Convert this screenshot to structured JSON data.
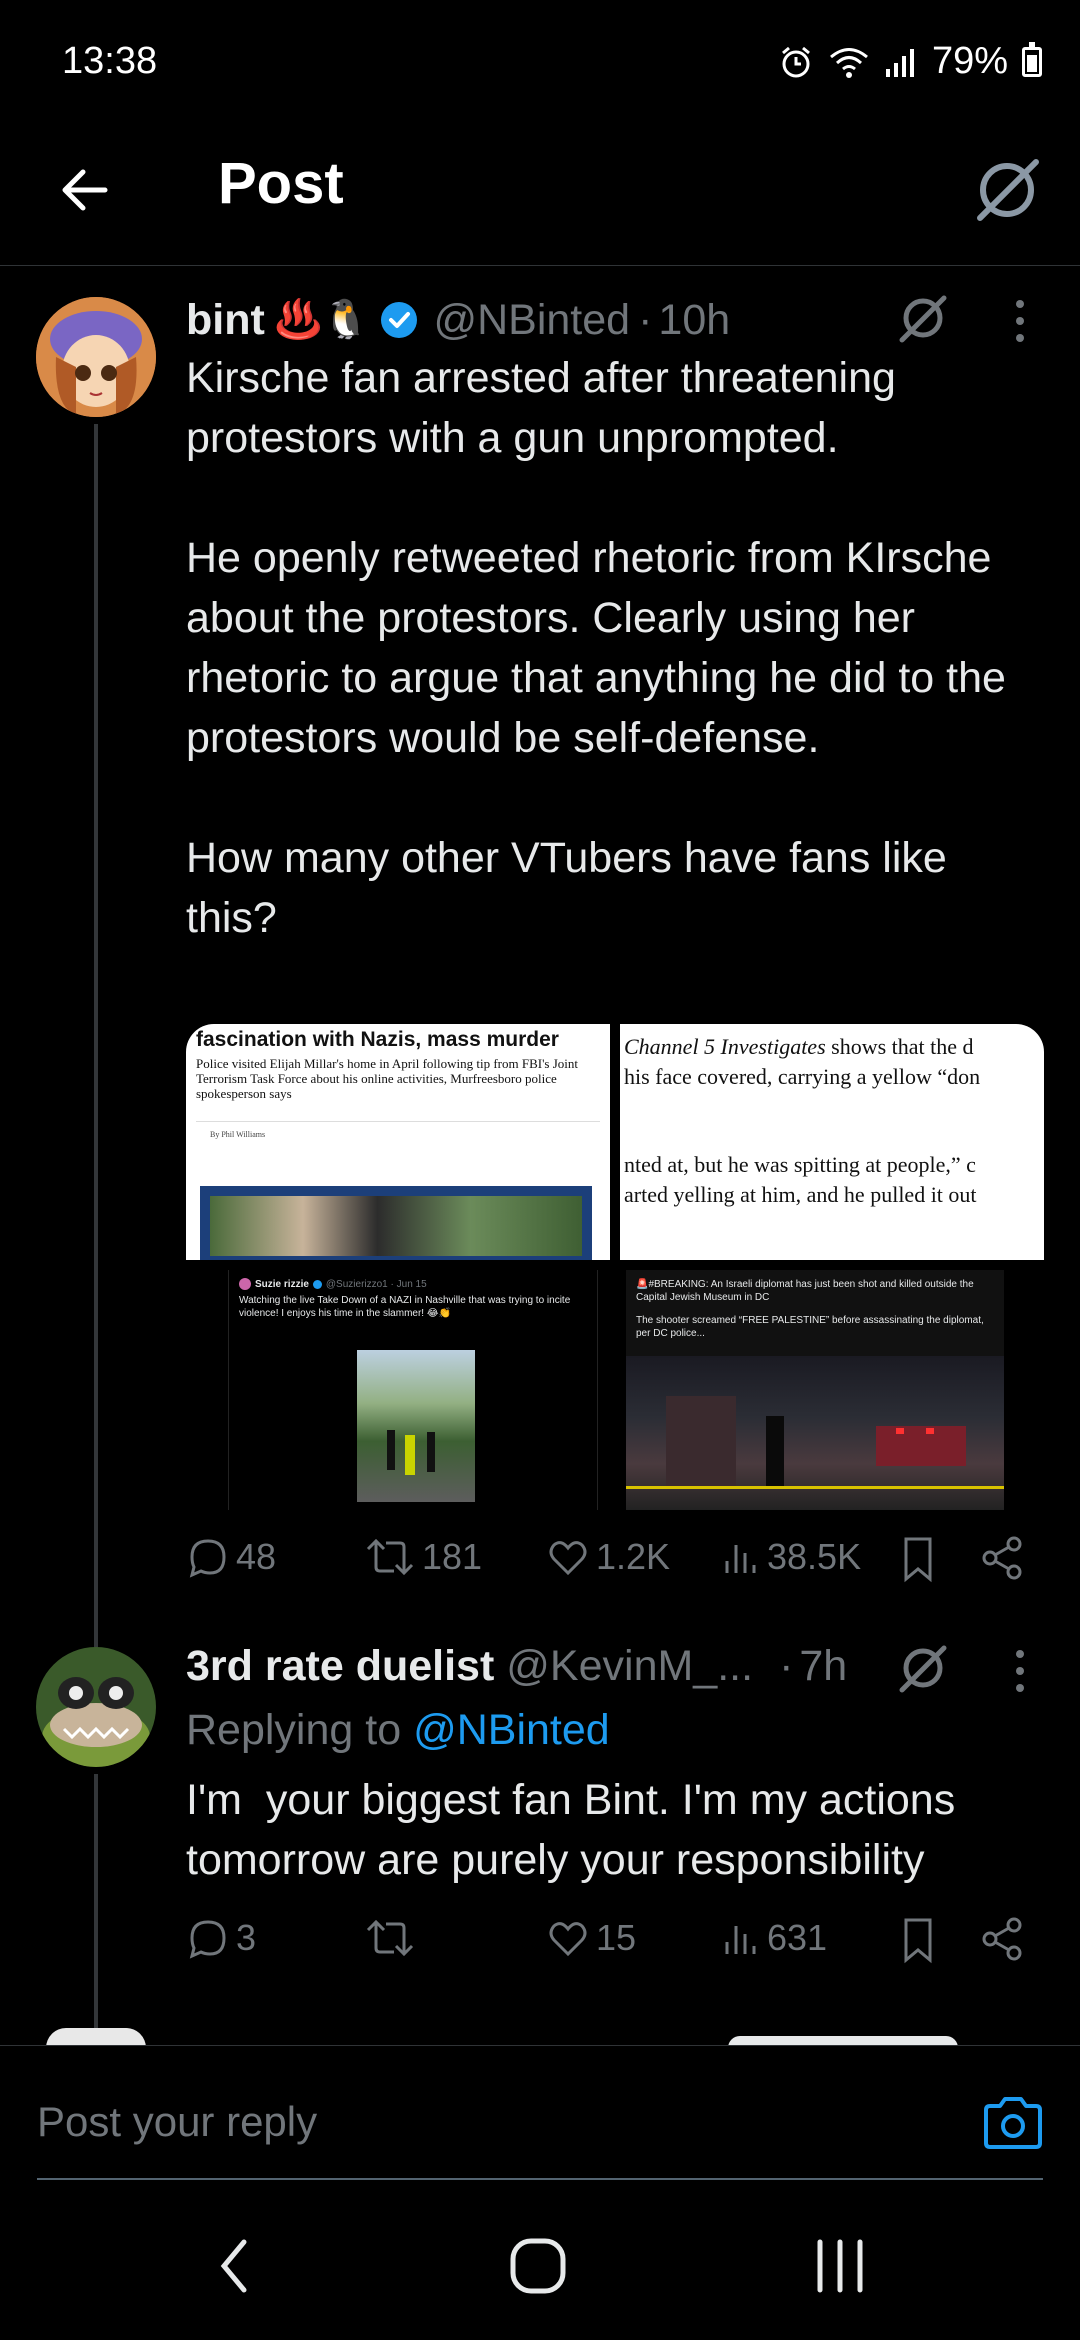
{
  "status_bar": {
    "time": "13:38",
    "battery": "79%"
  },
  "header": {
    "title": "Post"
  },
  "main_post": {
    "display_name": "bint",
    "name_emojis": "♨️🐧",
    "handle": "@NBinted",
    "separator": "·",
    "time": "10h",
    "text": "Kirsche fan arrested after threatening protestors with a gun unprompted.\n\nHe openly retweeted rhetoric from KIrsche about the protestors. Clearly using her rhetoric to argue that anything he did to the protestors would be self-defense.\n\nHow many other VTubers have fans like this?",
    "media": [
      {
        "headline": "fascination with Nazis, mass murder",
        "subhead": "Police visited Elijah Millar's home in April following tip from FBI's Joint Terrorism Task Force about his online activities, Murfreesboro police spokesperson says",
        "byline": "By Phil Williams"
      },
      {
        "line1_italic": "Channel 5 Investigates",
        "line1_rest": " shows that the d",
        "line2": "his face covered, carrying a yellow “don",
        "line3": "nted at, but he was spitting at people,” c",
        "line4": "arted yelling at him, and he pulled it out"
      },
      {
        "user": "Suzie rizzie",
        "handle": "@Suzierizzo1 · Jun 15",
        "text": "Watching the live Take Down of a NAZI in Nashville that was trying to incite violence! I enjoys his time in the slammer! 😂👏"
      },
      {
        "text": "🚨#BREAKING: An Israeli diplomat has just been shot and killed outside the Capital Jewish Museum in DC",
        "text2": "The shooter screamed “FREE PALESTINE” before assassinating the diplomat, per DC police..."
      }
    ],
    "stats": {
      "replies": "48",
      "reposts": "181",
      "likes": "1.2K",
      "views": "38.5K"
    }
  },
  "reply_post": {
    "display_name": "3rd rate duelist",
    "handle": "@KevinM_...",
    "separator": "·",
    "time": "7h",
    "replying_to_label": "Replying to ",
    "replying_to_handle": "@NBinted",
    "text": "I'm  your biggest fan Bint. I'm my actions tomorrow are purely your responsibility",
    "stats": {
      "replies": "3",
      "likes": "15",
      "views": "631"
    }
  },
  "reply_input": {
    "placeholder": "Post your reply"
  },
  "colors": {
    "accent": "#1d9bf0",
    "muted": "#71767b",
    "text": "#e7e9ea",
    "background": "#000000"
  }
}
